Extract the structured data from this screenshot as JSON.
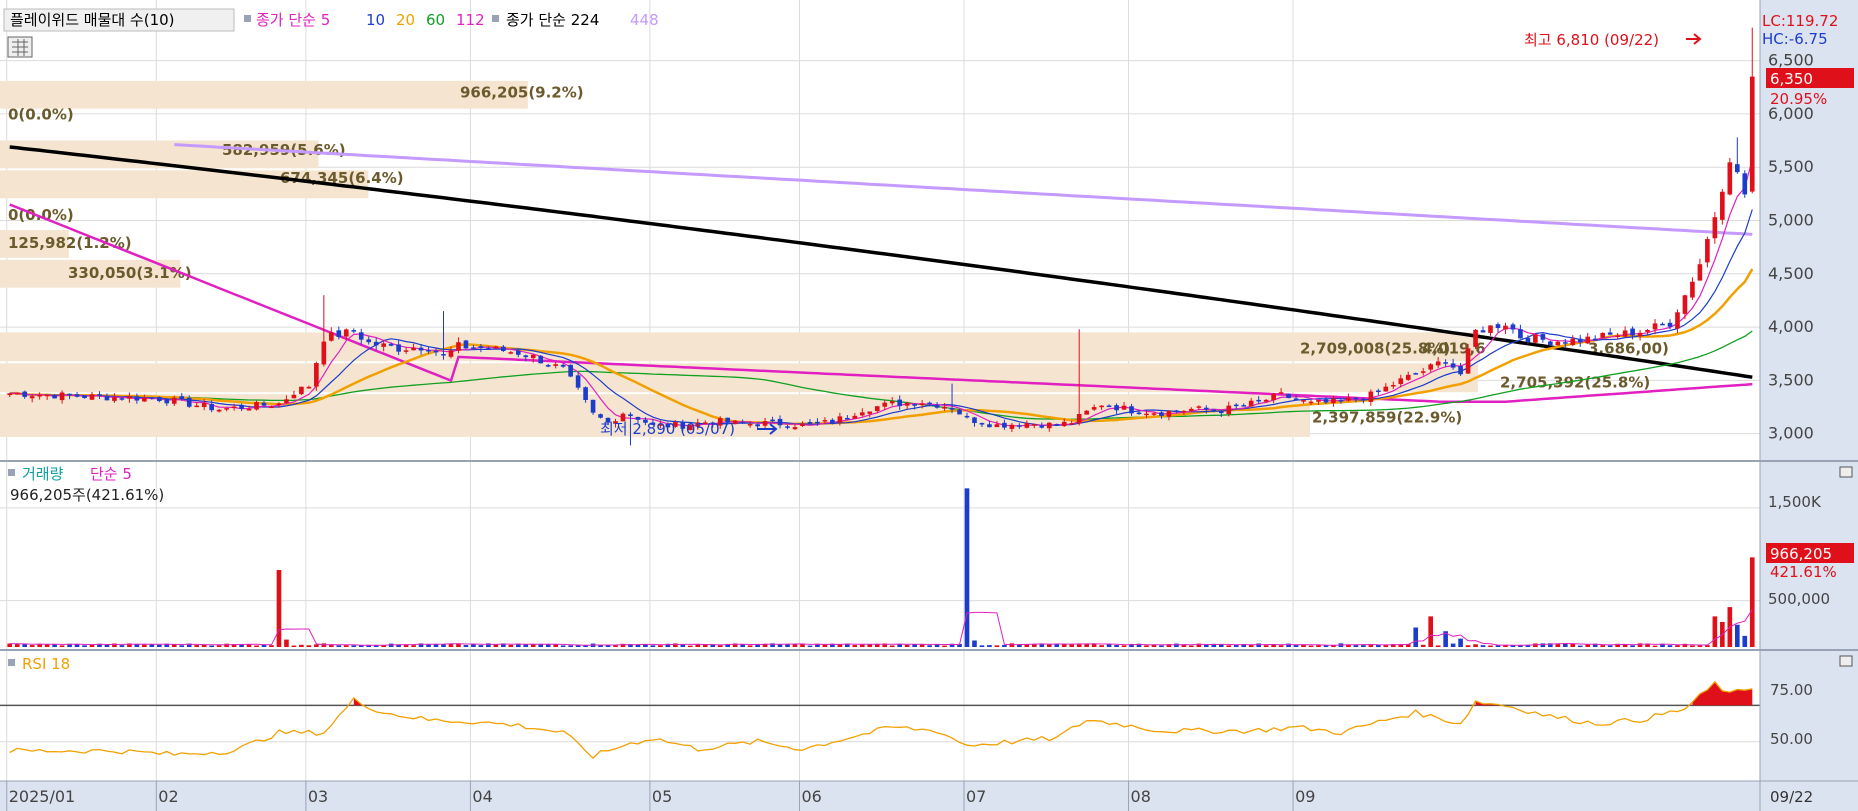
{
  "price_panel": {
    "legend": [
      {
        "text": "플레이위드 매물대 수(10)",
        "color": "#000000",
        "boxed": true
      },
      {
        "text": "종가 단순 5",
        "color": "#e020c0"
      },
      {
        "text": "10",
        "color": "#1c3ccc"
      },
      {
        "text": "20",
        "color": "#f2a000"
      },
      {
        "text": "60",
        "color": "#11a022"
      },
      {
        "text": "112",
        "color": "#e020c0"
      },
      {
        "text": "종가 단순 224",
        "color": "#000000"
      },
      {
        "text": "448",
        "color": "#c49aff"
      }
    ],
    "right_axis": {
      "lc": "LC:119.72",
      "hc": "HC:-6.75",
      "ticks": [
        "6,500",
        "6,000",
        "5,500",
        "5,000",
        "4,500",
        "4,000",
        "3,500",
        "3,000"
      ],
      "current_price": "6,350",
      "current_change": "20.95%"
    },
    "high_marker": "최고 6,810 (09/22)",
    "low_marker": "최저 2,890 (05/07)",
    "volume_profile_labels": [
      "966,205(9.2%)",
      "0(0.0%)",
      "582,959(5.6%)",
      "674,345(6.4%)",
      "0(0.0%)",
      "125,982(1.2%)",
      "330,050(3.1%)",
      "2,709,008(25.8%)",
      "4,019,6",
      "3,686,00)",
      "2,705,392(25.8%)",
      "2,397,859(22.9%)"
    ]
  },
  "volume_panel": {
    "title": "거래량",
    "ma_label": "단순 5",
    "info": "966,205주(421.61%)",
    "ticks": [
      "1,500K",
      "500,000"
    ],
    "current_volume": "966,205",
    "current_pct": "421.61%"
  },
  "rsi_panel": {
    "title": "RSI 18",
    "ticks": [
      "75.00",
      "50.00"
    ]
  },
  "x_axis": {
    "labels": [
      "2025/01",
      "02",
      "03",
      "04",
      "05",
      "06",
      "07",
      "08",
      "09"
    ],
    "current_date": "09/22"
  },
  "colors": {
    "up": "#e0101a",
    "down": "#1c3ccc",
    "ma5": "#e020c0",
    "ma10": "#1c3ccc",
    "ma20": "#f2a000",
    "ma60": "#11a022",
    "ma112": "#e020c0",
    "ma224": "#000000",
    "ma448": "#c49aff",
    "profile": "#f5e5d0",
    "rsi": "#f2a000",
    "axis_bg": "#dbe3f0"
  },
  "chart_data": {
    "type": "candlestick",
    "x_range": [
      "2025/01",
      "09/22"
    ],
    "price_range": [
      2800,
      6900
    ],
    "price_close_anchors": [
      [
        0,
        3380
      ],
      [
        10,
        3350
      ],
      [
        20,
        3330
      ],
      [
        28,
        3230
      ],
      [
        36,
        3280
      ],
      [
        38,
        3390
      ],
      [
        40,
        3450
      ],
      [
        42,
        3900
      ],
      [
        46,
        3960
      ],
      [
        48,
        3850
      ],
      [
        52,
        3800
      ],
      [
        56,
        3820
      ],
      [
        58,
        3720
      ],
      [
        60,
        3820
      ],
      [
        64,
        3800
      ],
      [
        68,
        3760
      ],
      [
        70,
        3720
      ],
      [
        74,
        3600
      ],
      [
        76,
        3400
      ],
      [
        78,
        3180
      ],
      [
        80,
        3100
      ],
      [
        82,
        3200
      ],
      [
        84,
        3150
      ],
      [
        86,
        3070
      ],
      [
        90,
        3080
      ],
      [
        94,
        3120
      ],
      [
        98,
        3090
      ],
      [
        102,
        3100
      ],
      [
        106,
        3080
      ],
      [
        110,
        3110
      ],
      [
        114,
        3230
      ],
      [
        118,
        3280
      ],
      [
        122,
        3300
      ],
      [
        126,
        3250
      ],
      [
        128,
        3140
      ],
      [
        132,
        3080
      ],
      [
        136,
        3100
      ],
      [
        140,
        3080
      ],
      [
        142,
        3110
      ],
      [
        144,
        3200
      ],
      [
        146,
        3280
      ],
      [
        150,
        3220
      ],
      [
        154,
        3200
      ],
      [
        158,
        3230
      ],
      [
        162,
        3220
      ],
      [
        166,
        3280
      ],
      [
        170,
        3360
      ],
      [
        174,
        3280
      ],
      [
        178,
        3300
      ],
      [
        182,
        3360
      ],
      [
        186,
        3500
      ],
      [
        190,
        3620
      ],
      [
        192,
        3700
      ],
      [
        194,
        3560
      ],
      [
        196,
        3960
      ],
      [
        200,
        4040
      ],
      [
        202,
        3910
      ],
      [
        206,
        3870
      ],
      [
        210,
        3880
      ],
      [
        214,
        3920
      ],
      [
        218,
        3960
      ],
      [
        222,
        4040
      ],
      [
        224,
        4300
      ],
      [
        226,
        4600
      ],
      [
        228,
        5050
      ],
      [
        230,
        5600
      ],
      [
        232,
        5250
      ],
      [
        233,
        6350
      ]
    ],
    "price_high_point": {
      "date": "09/22",
      "value": 6810
    },
    "price_low_point": {
      "date": "05/07",
      "value": 2890
    },
    "volume_range": [
      0,
      1800000
    ],
    "volume_last": 966205,
    "volume_spikes": [
      {
        "date": "02/24",
        "value": 830000
      },
      {
        "date": "06/26",
        "value": 1710000
      },
      {
        "date": "08/13",
        "value": 330000
      },
      {
        "date": "09/16",
        "value": 430000
      },
      {
        "date": "09/22",
        "value": 966205
      }
    ],
    "rsi_range": [
      30,
      95
    ],
    "rsi_reference": 70,
    "rsi_anchors": [
      [
        0,
        45
      ],
      [
        14,
        45
      ],
      [
        22,
        43
      ],
      [
        30,
        45
      ],
      [
        36,
        55
      ],
      [
        42,
        55
      ],
      [
        46,
        73
      ],
      [
        50,
        66
      ],
      [
        56,
        62
      ],
      [
        62,
        61
      ],
      [
        68,
        59
      ],
      [
        74,
        55
      ],
      [
        78,
        42
      ],
      [
        82,
        48
      ],
      [
        86,
        52
      ],
      [
        92,
        46
      ],
      [
        100,
        50
      ],
      [
        106,
        46
      ],
      [
        112,
        52
      ],
      [
        118,
        58
      ],
      [
        124,
        56
      ],
      [
        128,
        48
      ],
      [
        134,
        50
      ],
      [
        140,
        52
      ],
      [
        144,
        62
      ],
      [
        148,
        60
      ],
      [
        154,
        56
      ],
      [
        160,
        56
      ],
      [
        166,
        56
      ],
      [
        172,
        58
      ],
      [
        178,
        55
      ],
      [
        184,
        62
      ],
      [
        188,
        66
      ],
      [
        194,
        60
      ],
      [
        196,
        72
      ],
      [
        200,
        70
      ],
      [
        206,
        64
      ],
      [
        212,
        60
      ],
      [
        218,
        62
      ],
      [
        224,
        68
      ],
      [
        228,
        82
      ],
      [
        230,
        76
      ],
      [
        233,
        80
      ]
    ],
    "volume_profile": [
      {
        "low": 6040,
        "high": 6320,
        "volume": 966205,
        "pct": 9.2
      },
      {
        "low": 5760,
        "high": 6040,
        "volume": 0,
        "pct": 0.0
      },
      {
        "low": 5480,
        "high": 5760,
        "volume": 582959,
        "pct": 5.6
      },
      {
        "low": 5200,
        "high": 5480,
        "volume": 674345,
        "pct": 6.4
      },
      {
        "low": 4920,
        "high": 5200,
        "volume": 0,
        "pct": 0.0
      },
      {
        "low": 4640,
        "high": 4920,
        "volume": 125982,
        "pct": 1.2
      },
      {
        "low": 4360,
        "high": 4640,
        "volume": 330050,
        "pct": 3.1
      },
      {
        "low": 3670,
        "high": 3960,
        "volume": 2709008,
        "pct": 25.8
      },
      {
        "low": 3380,
        "high": 3670,
        "volume": 2705392,
        "pct": 25.8
      },
      {
        "low": 2960,
        "high": 3380,
        "volume": 2397859,
        "pct": 22.9
      }
    ],
    "ma_lines": [
      {
        "name": "224",
        "start_value": 5690,
        "end_value": 3530
      },
      {
        "name": "448",
        "start_value": 5800,
        "end_value": 4870
      }
    ]
  }
}
